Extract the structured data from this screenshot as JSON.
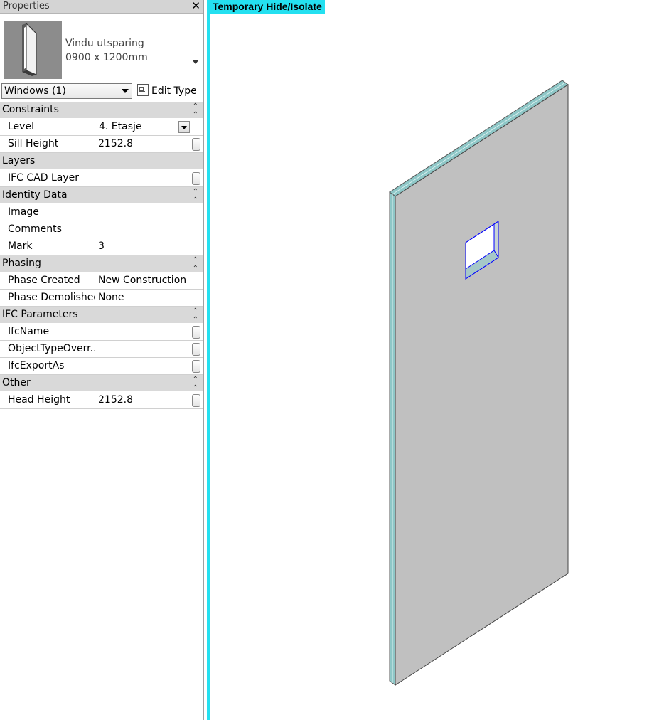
{
  "palette": {
    "title": "Properties",
    "close_glyph": "✕",
    "type_selector": {
      "family": "Vindu utsparing",
      "type": "0900 x 1200mm"
    },
    "filter": {
      "value": "Windows (1)"
    },
    "edit_type_label": "Edit Type",
    "groups": {
      "constraints": {
        "label": "Constraints",
        "level": {
          "name": "Level",
          "value": "4. Etasje"
        },
        "sill_height": {
          "name": "Sill Height",
          "value": "2152.8"
        }
      },
      "layers": {
        "label": "Layers",
        "ifc_cad_layer": {
          "name": "IFC CAD Layer",
          "value": ""
        }
      },
      "identity": {
        "label": "Identity Data",
        "image": {
          "name": "Image",
          "value": ""
        },
        "comments": {
          "name": "Comments",
          "value": ""
        },
        "mark": {
          "name": "Mark",
          "value": "3"
        }
      },
      "phasing": {
        "label": "Phasing",
        "phase_created": {
          "name": "Phase Created",
          "value": "New Construction"
        },
        "phase_demolished": {
          "name": "Phase Demolished",
          "value": "None"
        }
      },
      "ifc": {
        "label": "IFC Parameters",
        "ifc_name": {
          "name": "IfcName",
          "value": ""
        },
        "object_type": {
          "name": "ObjectTypeOverr...",
          "value": ""
        },
        "export_as": {
          "name": "IfcExportAs",
          "value": ""
        }
      },
      "other": {
        "label": "Other",
        "head_height": {
          "name": "Head Height",
          "value": "2152.8"
        }
      }
    }
  },
  "view": {
    "banner": "Temporary Hide/Isolate",
    "colors": {
      "isolate_border": "#24e0f0",
      "wall_face": "#c0c0c0",
      "wall_edge": "#8ec7c7",
      "selection": "#0000ff"
    }
  }
}
